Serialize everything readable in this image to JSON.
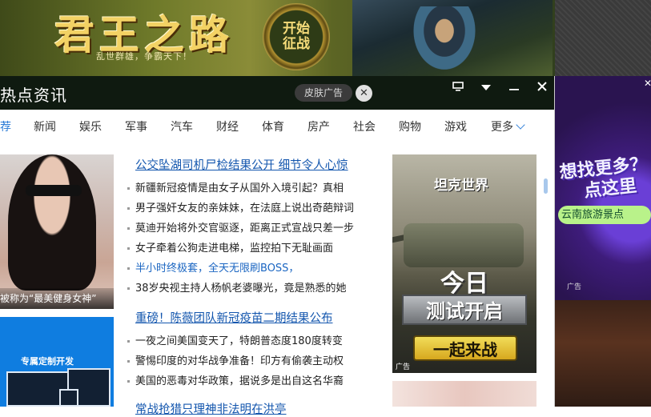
{
  "top_banner": {
    "title": "君王之路",
    "slogan": "乱世群雄，争霸天下！",
    "badge_line1": "开始",
    "badge_line2": "征战"
  },
  "window": {
    "title": "热点资讯",
    "skin_ad_label": "皮肤广告",
    "close_circle": "✕",
    "monitor_icon": "monitor-icon",
    "dropdown_icon": "chevron-down-icon",
    "minimize_icon": "minimize-icon",
    "close_icon": "close-icon"
  },
  "nav": {
    "tabs": [
      "荐",
      "新闻",
      "娱乐",
      "军事",
      "汽车",
      "财经",
      "体育",
      "房产",
      "社会",
      "购物",
      "游戏",
      "更多"
    ],
    "active_index": 0
  },
  "images": {
    "img1_caption": "被称为“最美健身女神”",
    "img2_title": "专属定制开发"
  },
  "articles": {
    "group1": {
      "headline": "公交坠湖司机尸检结果公开 细节令人心惊",
      "items": [
        {
          "text": "新疆新冠疫情是由女子从国外入境引起？真相",
          "blue": false
        },
        {
          "text": "男子强奸女友的亲妹妹，在法庭上说出奇葩辩词",
          "blue": false
        },
        {
          "text": "莫迪开始将外交官驱逐，距离正式宣战只差一步",
          "blue": false
        },
        {
          "text": "女子牵着公狗走进电梯，监控拍下无耻画面",
          "blue": false
        },
        {
          "text": "半小时终极套，全天无限刷BOSS，",
          "blue": true
        },
        {
          "text": "38岁央视主持人杨帆老婆曝光，竟是熟悉的她",
          "blue": false
        }
      ]
    },
    "group2": {
      "headline": "重磅！陈薇团队新冠疫苗二期结果公布",
      "items": [
        {
          "text": "一夜之间美国变天了，特朗普态度180度转变",
          "blue": false
        },
        {
          "text": "警惕印度的对华战争准备！印方有偷袭主动权",
          "blue": false
        },
        {
          "text": "美国的恶毒对华政策，据说多是出自这名华裔",
          "blue": false
        }
      ]
    },
    "group3_headline": "常战抢猎只理神非法明在洪亭"
  },
  "tank_ad": {
    "logo": "坦克世界",
    "today": "今日",
    "test_open": "测试开启",
    "fight_button": "一起来战",
    "ad_mark": "广告"
  },
  "right_ad": {
    "close": "✕",
    "big_line1": "想找更多？",
    "big_line2": "点这里",
    "pill": "云南旅游景点",
    "ad_mark": "广告"
  }
}
